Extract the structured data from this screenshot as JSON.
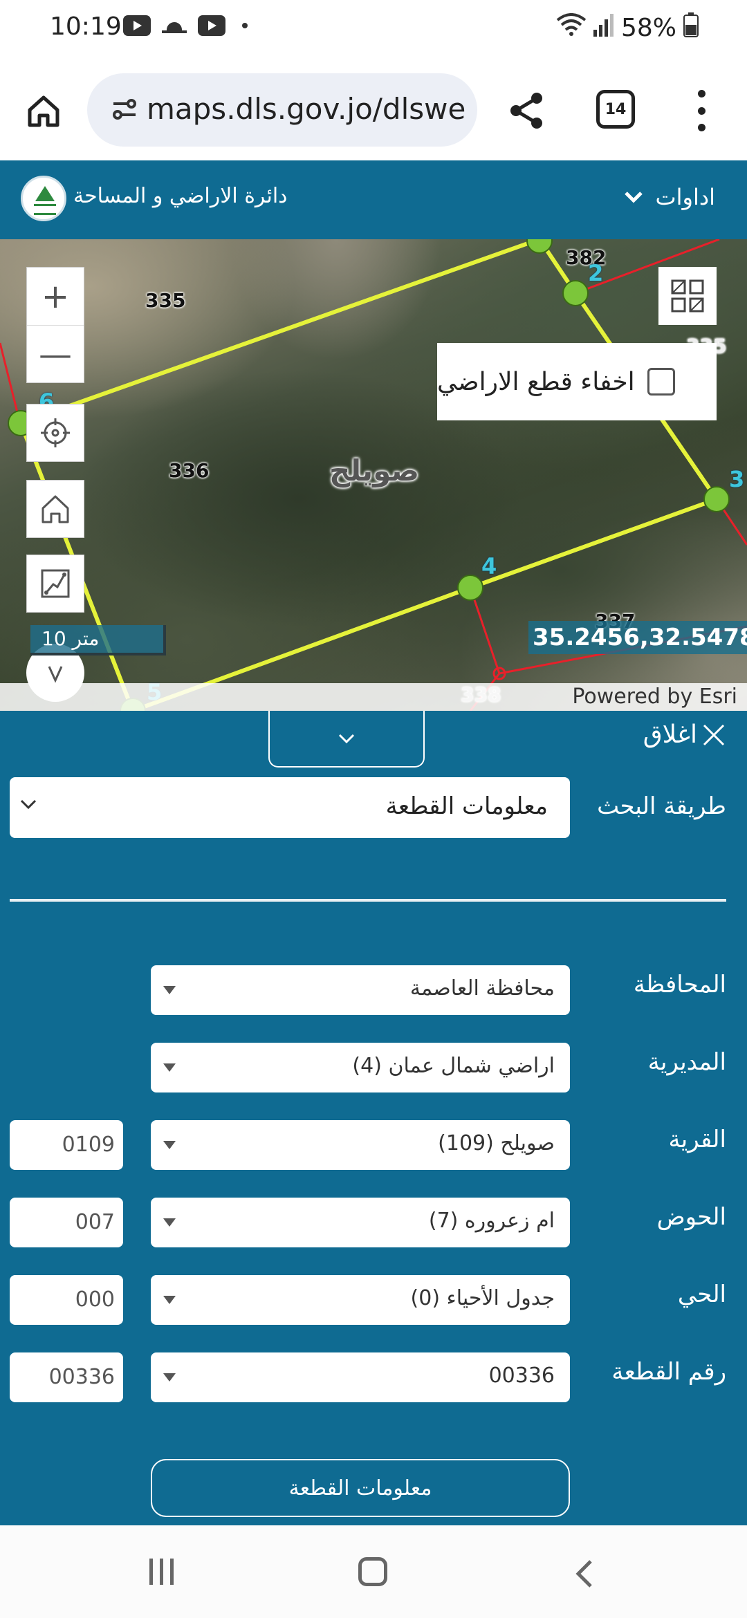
{
  "status_bar": {
    "time": "10:19",
    "battery": "58%",
    "icons": [
      "youtube-icon",
      "weather-icon",
      "youtube-icon",
      "dot-icon",
      "wifi-icon",
      "signal-icon",
      "battery-icon"
    ]
  },
  "browser": {
    "url": "maps.dls.gov.jo/dlswe",
    "tab_count": "14"
  },
  "header": {
    "org_name": "دائرة الاراضي و المساحة",
    "tools_label": "اداوات"
  },
  "map": {
    "zoom_in": "+",
    "zoom_out": "—",
    "parcel_labels": [
      "335",
      "336",
      "337",
      "338",
      "382",
      "335"
    ],
    "vertex_numbers": [
      "2",
      "3",
      "4",
      "5",
      "6"
    ],
    "district_label": "صويلح",
    "hide_parcels_label": "اخفاء قطع الاراضي",
    "scale_label": "10 متر",
    "coordinates": "35.2456,32.5478",
    "attribution": "Powered by Esri",
    "colors": {
      "parcel_outline": "#e5f23a",
      "neighbor_line": "#e8202a",
      "vertex": "#7cc63a"
    }
  },
  "panel": {
    "close_label": "اغلاق",
    "search_method_label": "طريقة البحث",
    "search_method_value": "معلومات القطعة",
    "fields": [
      {
        "label": "المحافظة",
        "value": "محافظة العاصمة",
        "code": ""
      },
      {
        "label": "المديرية",
        "value": "اراضي شمال عمان (4)",
        "code": ""
      },
      {
        "label": "القرية",
        "value": "صويلح (109)",
        "code": "0109"
      },
      {
        "label": "الحوض",
        "value": "ام زعروره (7)",
        "code": "007"
      },
      {
        "label": "الحي",
        "value": "جدول الأحياء (0)",
        "code": "000"
      },
      {
        "label": "رقم القطعة",
        "value": "00336",
        "code": "00336"
      }
    ],
    "submit_label": "معلومات القطعة",
    "colors": {
      "background": "#0f6b92"
    }
  }
}
